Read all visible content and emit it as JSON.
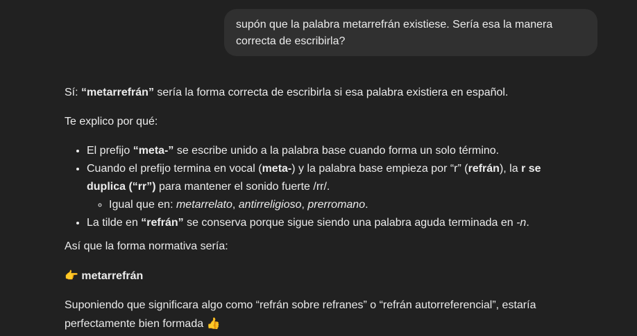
{
  "user_message": {
    "text": "supón que la palabra metarrefrán existiese. Sería esa la manera correcta de escribirla?"
  },
  "assistant": {
    "intro": {
      "pre": "Sí: ",
      "term": "“metarrefrán”",
      "post": " sería la forma correcta de escribirla si esa palabra existiera en español."
    },
    "why": "Te explico por qué:",
    "bullet1": {
      "pre": "El prefijo ",
      "bold": "“meta-”",
      "post": " se escribe unido a la palabra base cuando forma un solo término."
    },
    "bullet2": {
      "a": "Cuando el prefijo termina en vocal (",
      "b": "meta-",
      "c": ") y la palabra base empieza por “r” (",
      "d": "refrán",
      "e": "), la ",
      "f": "r se duplica (“rr”)",
      "g": " para mantener el sonido fuerte /rr/."
    },
    "subbullet": {
      "pre": "Igual que en: ",
      "ex1": "metarrelato",
      "sep1": ", ",
      "ex2": "antirreligioso",
      "sep2": ", ",
      "ex3": "prerromano",
      "end": "."
    },
    "bullet3": {
      "pre": "La tilde en ",
      "bold": "“refrán”",
      "mid": " se conserva porque sigue siendo una palabra aguda terminada en ",
      "ital": "-n",
      "end": "."
    },
    "asi": "Así que la forma normativa sería:",
    "final": {
      "emoji": "👉",
      "word": "metarrefrán"
    },
    "closing": {
      "text": "Suponiendo que significara algo como “refrán sobre refranes” o “refrán autorreferencial”, estaría perfectamente bien formada ",
      "emoji": "👍"
    }
  }
}
